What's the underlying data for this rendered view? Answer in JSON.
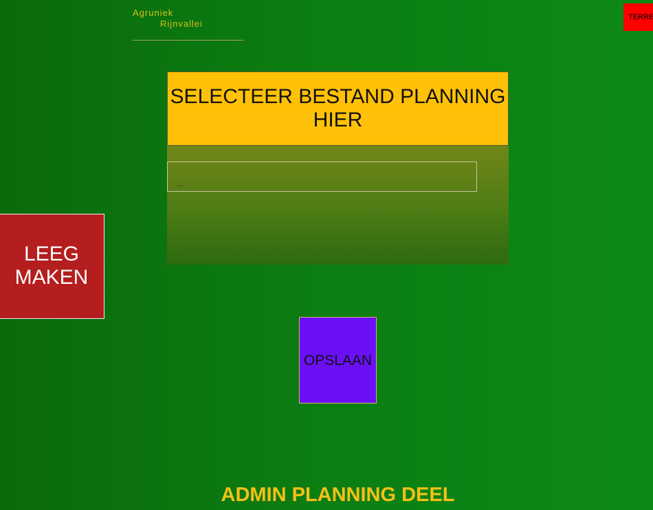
{
  "logo": {
    "line1": "Agruniek",
    "line2": "Rijnvallei"
  },
  "corner_button": {
    "label": "TERREIN"
  },
  "upload_panel": {
    "title": "SELECTEER BESTAND PLANNING HIER",
    "file_input_placeholder": "..."
  },
  "clear_button": {
    "label": "LEEG MAKEN"
  },
  "save_button": {
    "label": "OPSLAAN"
  },
  "footer": {
    "title": "ADMIN PLANNING DEEL"
  },
  "colors": {
    "background": "#0c7e12",
    "panel_header": "#ffc107",
    "clear_button": "#b41e1e",
    "save_button": "#6b10f5",
    "corner_button": "#ff0000",
    "footer_text": "#f5c016",
    "logo_text": "#d9c21a"
  }
}
